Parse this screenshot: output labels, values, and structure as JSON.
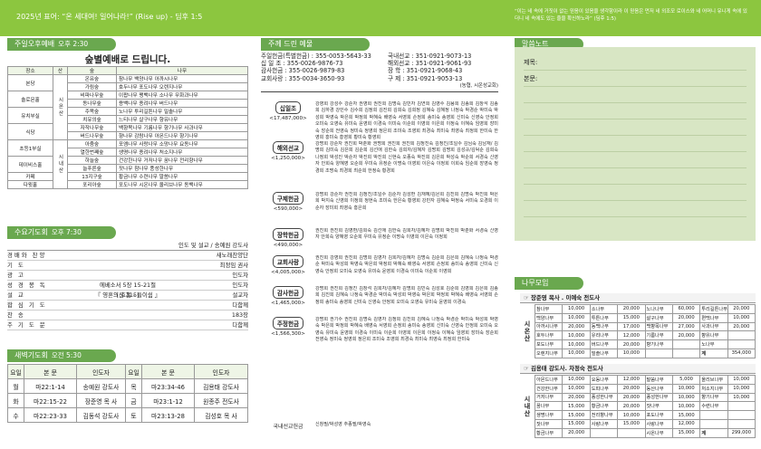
{
  "header": {
    "left": "2025년 표어: “온 세대여! 일어나라!” (Rise up) - 딤후 1:5",
    "right": "“이는 네 속에 거짓이 없는 믿음이 있음을 생각함이라 이 믿음은 먼저 네 외조모 로이스와 네 어머니 유니게 속에 있더니 네 속에도 있는 줄을 확신하노라” (딤후 1:5)"
  },
  "sunday": {
    "header": "주일오후예배",
    "time": "오후 2:30",
    "title": "숲별예배로 드립니다.",
    "columns": [
      "장소",
      "산",
      "숲",
      "나무"
    ],
    "rows": [
      [
        "본당",
        "",
        "온유숲",
        "참나무 백양나무 아까시나무"
      ],
      [
        "",
        "",
        "가림숲",
        "호두나무 포도나무 오렌지나무"
      ],
      [
        "솔로몬홀",
        "",
        "비파나무숲",
        "이팝나무 팽백나무 소나무 무화과나무"
      ],
      [
        "",
        "",
        "동나무숲",
        "용백나무 종려나무 버드나무"
      ],
      [
        "유치부실",
        "",
        "주목숲",
        "노나무 투리길튼나무 밀솔나무"
      ],
      [
        "",
        "",
        "치유의숲",
        "느티나무 살구나무 향유나무"
      ],
      [
        "식당",
        "",
        "자작나무숲",
        "백향목나무 기름나무 향기나무 사과나무"
      ],
      [
        "",
        "",
        "버드나무숲",
        "향나무 감람나무 아몬드나무 향기나무"
      ],
      [
        "초등1부실",
        "",
        "아줌숲",
        "포엠나무 사랑나무 소망나무 요동나무"
      ],
      [
        "",
        "",
        "열한번째숲",
        "생명나무 종려나무 처소지나무"
      ],
      [
        "데이비스홀",
        "",
        "하늘숲",
        "건강한나무 거저나무 꿈나무 전리향나무"
      ],
      [
        "",
        "",
        "늘푸른숲",
        "잣나무 참나무 풍성한나무"
      ],
      [
        "카페",
        "",
        "13지구숲",
        "황금나무 수련나무 말씀나무"
      ],
      [
        "다윗홀",
        "",
        "포리아숲",
        "포도나무 시온나무 올리브나무 동백나무"
      ]
    ],
    "mountains": [
      "시온산",
      "시내산"
    ]
  },
  "wednesday": {
    "header": "수요기도회",
    "time": "오후 7:30",
    "leader": "인도 및 설교 / 송예원 강도사",
    "rows": [
      {
        "k": "경배와 찬양",
        "m": "",
        "v": "새노래찬양단"
      },
      {
        "k": "기 도",
        "m": "",
        "v": "최정임 권사"
      },
      {
        "k": "광 고",
        "m": "",
        "v": "인도자"
      },
      {
        "k": "성 경 봉 독",
        "m": "에베소서 5장 15-21절(신.315)",
        "v": "인도자"
      },
      {
        "k": "설 교",
        "m": "『 영혼의 호흡 - 들이쉼 』",
        "v": "설교자"
      },
      {
        "k": "합 심 기 도",
        "m": "",
        "v": "다함께"
      },
      {
        "k": "찬 송",
        "m": "",
        "v": "183장"
      },
      {
        "k": "주 기 도 문",
        "m": "",
        "v": "다함께"
      }
    ]
  },
  "dawn": {
    "header": "새벽기도회",
    "time": "오전 5:30",
    "columns": [
      "요일",
      "본 문",
      "인도자",
      "요일",
      "본 문",
      "인도자"
    ],
    "rows": [
      [
        "월",
        "마22:1-14",
        "송예원 강도사",
        "목",
        "마23:34-46",
        "김용태 강도사"
      ],
      [
        "화",
        "마22:15-22",
        "장준영 목 사",
        "금",
        "마23:1-12",
        "원종주 전도사"
      ],
      [
        "수",
        "마22:23-33",
        "김동석 강도사",
        "토",
        "마23:13-28",
        "김성호 목 사"
      ]
    ]
  },
  "offering": {
    "header": "주께 드린 예물",
    "accounts": [
      [
        "주일헌금(특별헌금) : 355-0053-5643-33",
        "국내선교 : 351-0921-9073-13"
      ],
      [
        "십 일 조 : 355-0026-9876-73",
        "해외선교 : 351-0921-9061-93"
      ],
      [
        "감사헌금 : 355-0026-9879-83",
        "장 학 : 351-0921-9068-43"
      ],
      [
        "교회사랑 : 355-0034-3650-93",
        "구 제 : 351-0921-9053-13"
      ]
    ],
    "note": "(농협, 시온성교회)",
    "items": [
      {
        "name": "십일조",
        "amount": "<17,487,000>",
        "text": "강영희 강성수 강순자 권영희 권진희 김명숙 김민자 김연희 김영수 김용희 김종희 김창석 김종희 김하경 강민수 김수희 김정희 김진희 김희숙 김희정 김혜숙 김혜정 나정숙 박경순 박미숙 박성희 박영숙 박은희 박정희 박혜숙 배영숙 서영희 손정희 송미숙 송영희 신미숙 신영숙 안정희 오미숙 오영숙 유미숙 윤영희 이경숙 이미숙 이순희 이영희 이은희 이정숙 이혜숙 임영희 장미숙 장순희 전영숙 정미숙 정영희 정은희 조미숙 조영희 최경숙 최미숙 최영숙 최정희 한미숙 한영희 홍미숙 홍영희 황미숙 황영희"
      },
      {
        "name": "해외선교",
        "amount": "<1,250,000>",
        "text": "강명희 강순자 권진희 박춘화 권명희 권진희 권진희 김정진숙 김정진/조일수 김님숙 김남재/ 김명희 김미숙 김은희 김순희 김선애 김한숙 김희자/김혜자 김명희 김명희 김성규/김덕순 김희숙 나정희 박성진 박순자 박진희 박진희 신현숙 오종숙 박진희 김은희 박성숙 박순희 서경숙 신영자 안희숙 양혜영 오순희 우미숙 유정순 이명숙 이영희 이은숙 이정희 이희숙 임순희 장영숙 정경희 조명숙 최경희 최순희 한정숙 황경희"
      },
      {
        "name": "구제헌금",
        "amount": "<590,000>",
        "text": "강명희 강순자 권진희 김정진/조일수 김순자 김성환 김재혜/김은희 김진희 김명숙 박진희 박은희 박지숙 신영희 이정희 정현숙 조미숙 한은숙 황영희 강민자 김혜숙 박정숙 서미숙 오경희 이순자 장미희 최영숙 홍은희"
      },
      {
        "name": "장학헌금",
        "amount": "<490,000>",
        "text": "권진희 권진희 김영환/김희숙 김선애 김한숙 김희자/김혜자 김명희 박진희 박춘화 서경숙 신영자 안희숙 양혜영 오순희 우미숙 유정순 이명숙 이영희 이은숙 이정희"
      },
      {
        "name": "교회사랑",
        "amount": "<4,005,000>",
        "text": "권진희 강영희 권진희 김명희 김영자 김희자/김혜자 김명숙 김순희 김은희 김혜숙 나정숙 박경순 박미숙 박성희 박영숙 박은희 박정희 박혜숙 배영숙 서영희 손정희 송미숙 송영희 신미숙 신영숙 안정희 오미숙 오영숙 유미숙 윤영희 이경숙 이미숙 이순희 이영희"
      },
      {
        "name": "감사헌금",
        "amount": "<1,465,000>",
        "text": "강명희 권진희 김정진 김창석 김희자/김혜자 김명희 김민숙 김성호 김순희 김영희 김은희 김종희 김진희 김혜숙 나정숙 박경순 박미숙 박성희 박영숙 박은희 박정희 박혜숙 배영숙 서영희 손정희 송미숙 송영희 신미숙 신영숙 안정희 오미숙 오영숙 유미숙 윤영희 이경숙"
      },
      {
        "name": "주정헌금",
        "amount": "<1,566,300>",
        "text": "강명희 권기수 권진희 김명숙 김영자 김정희 김진희 김혜숙 나정숙 박경순 박미숙 박성희 박영숙 박은희 박정희 박혜숙 배영숙 서영희 손정희 송미숙 송영희 신미숙 신영숙 안정희 오미숙 오영숙 유미숙 윤영희 이경숙 이미숙 이순희 이영희 이은희 이정숙 이혜숙 임영희 장미숙 장순희 전영숙 정미숙 정영희 정은희 조미숙 조영희 최경숙 최미숙 최영숙 최정희 한미숙"
      }
    ],
    "footer_label": "국내선교헌금",
    "footer_text": "신창필/박성영 추종필/박영숙"
  },
  "sermon_notes": {
    "header": "말씀노트",
    "title_label": "제목:",
    "body_label": "본문:"
  },
  "tree_group": {
    "header": "나무모임",
    "groups": [
      {
        "mountain": "시온산",
        "leader": "☞ 장준영 목사 . 이예숙 전도사",
        "rows": [
          [
            "참나무",
            "10,000",
            "소나무",
            "20,000",
            "노나나무",
            "60,000",
            "투리길튼나무",
            "20,000"
          ],
          [
            "백양나무",
            "10,000",
            "투튼나무",
            "15,000",
            "살구나무",
            "20,000",
            "편백나무",
            "10,000"
          ],
          [
            "아까시나무",
            "20,000",
            "동백나무",
            "17,000",
            "백향목나무",
            "27,000",
            "사과나무",
            "20,000"
          ],
          [
            "호두나무",
            "10,000",
            "유리나무",
            "12,000",
            "기름나무",
            "20,000",
            "향유나무",
            ""
          ],
          [
            "포도나무",
            "10,000",
            "버드나무",
            "20,000",
            "향기나무",
            "",
            "노나무",
            ""
          ],
          [
            "오렌지나무",
            "10,000",
            "밀솔나무",
            "10,000",
            "",
            "",
            "계",
            "354,000"
          ]
        ]
      },
      {
        "mountain": "시내산",
        "leader": "☞ 김용태 강도사. 차정숙 전도사",
        "rows": [
          [
            "아몬드나무",
            "10,000",
            "요동나무",
            "12,000",
            "말씀나무",
            "5,000",
            "올리브나무",
            "10,000"
          ],
          [
            "건강한나무",
            "10,000",
            "도피나무",
            "20,000",
            "동산나무",
            "10,000",
            "처소지나무",
            "10,000"
          ],
          [
            "거저나무",
            "20,000",
            "풍성한나무",
            "20,000",
            "풍성한나무",
            "10,000",
            "향기나무",
            "10,000"
          ],
          [
            "꿈나무",
            "15,000",
            "황금나무",
            "20,000",
            "잣나무",
            "10,000",
            "수련나무",
            ""
          ],
          [
            "생명나무",
            "15,000",
            "전리향나무",
            "10,000",
            "포도나무",
            "15,000",
            "",
            ""
          ],
          [
            "잣나무",
            "15,000",
            "사랑나무",
            "15,000",
            "사랑나무",
            "12,000",
            "",
            ""
          ],
          [
            "황금나무",
            "20,000",
            "",
            "",
            "시온나무",
            "15,000",
            "계",
            "299,000"
          ]
        ]
      }
    ]
  }
}
